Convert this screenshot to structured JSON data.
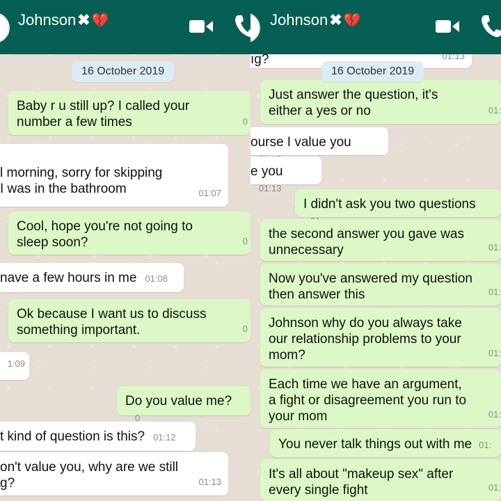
{
  "contact": {
    "name": "Johnson",
    "mark": "✖",
    "heart": "💔"
  },
  "icons": {
    "video": "video-call-icon",
    "phone": "phone-call-icon"
  },
  "left": {
    "date": "16 October 2019",
    "messages": [
      {
        "dir": "out",
        "text": "Baby r u still up? I called your\nnumber a few times",
        "time": "0"
      },
      {
        "dir": "in",
        "text": "l morning, sorry for skipping\nI was in the bathroom",
        "time": "01:07"
      },
      {
        "dir": "out",
        "text": "Cool, hope you're not going to\nsleep soon?",
        "time": "0"
      },
      {
        "dir": "in",
        "text": "nave a few hours in me",
        "time": "01:08"
      },
      {
        "dir": "out",
        "text": "Ok because I want us to discuss\nsomething important.",
        "time": "0"
      },
      {
        "dir": "in",
        "text": "",
        "time": "1:09"
      },
      {
        "dir": "out",
        "text": "Do you value me?",
        "time": "0"
      },
      {
        "dir": "in",
        "text": "t kind of question is this?",
        "time": "01:12"
      },
      {
        "dir": "in",
        "text": "on't value you, why are we still\ng?",
        "time": "01:13"
      }
    ]
  },
  "right": {
    "date": "16 October 2019",
    "messages": [
      {
        "dir": "in",
        "text": "ıg?",
        "time": "01:13"
      },
      {
        "dir": "out",
        "text": "Just answer the question, it's\neither a yes or no",
        "time": "01:"
      },
      {
        "dir": "in",
        "text": "ourse I value you",
        "time": "01:13"
      },
      {
        "dir": "in",
        "text": "e you",
        "time": "01:13"
      },
      {
        "dir": "out",
        "text": "I didn't ask you two questions",
        "time": "01:"
      },
      {
        "dir": "out",
        "text": "the second answer you gave was\nunnecessary",
        "time": "01:"
      },
      {
        "dir": "out",
        "text": "Now you've answered my question\nthen answer this",
        "time": "01:"
      },
      {
        "dir": "out",
        "text": "Johnson why do you always take\nour relationship problems to your\nmom?",
        "time": "01:"
      },
      {
        "dir": "out",
        "text": "Each time we have an argument,\na fight or disagreement you run to\nyour mom",
        "time": "01:"
      },
      {
        "dir": "out",
        "text": "You never talk things out with me",
        "time": "01:"
      },
      {
        "dir": "out",
        "text": "It's all about \"makeup sex\" after\nevery single fight",
        "time": "01:"
      }
    ]
  }
}
